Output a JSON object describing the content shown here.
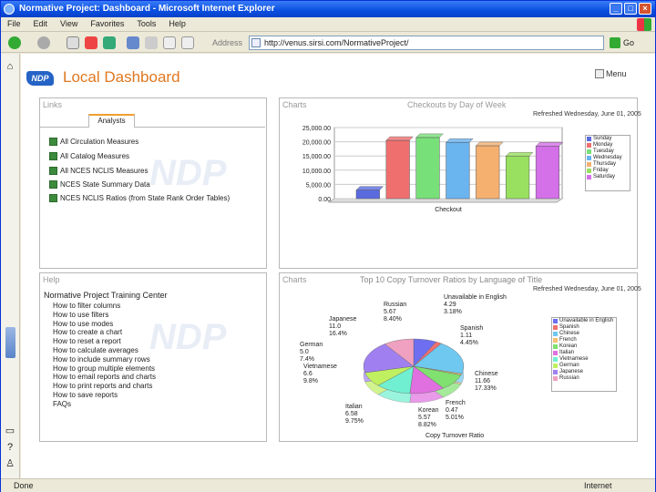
{
  "window": {
    "title": "Normative Project: Dashboard - Microsoft Internet Explorer"
  },
  "menu": [
    "File",
    "Edit",
    "View",
    "Favorites",
    "Tools",
    "Help"
  ],
  "address": {
    "label": "Address",
    "url": "http://venus.sirsi.com/NormativeProject/",
    "go": "Go"
  },
  "page": {
    "logo": "NDP",
    "title": "Local Dashboard",
    "menu_link": "Menu"
  },
  "links_panel": {
    "title": "Links",
    "tab": "Analysts",
    "items": [
      "All Circulation Measures",
      "All Catalog Measures",
      "All NCES NCLIS Measures",
      "NCES State Summary Data",
      "NCES NCLIS Ratios (from State Rank Order Tables)"
    ]
  },
  "help_panel": {
    "title": "Help",
    "heading": "Normative Project Training Center",
    "items": [
      "How to filter columns",
      "How to use filters",
      "How to use modes",
      "How to create a chart",
      "How to reset a report",
      "How to calculate averages",
      "How to include summary rows",
      "How to group multiple elements",
      "How to email reports and charts",
      "How to print reports and charts",
      "How to save reports",
      "FAQs"
    ]
  },
  "bar_panel": {
    "label": "Charts",
    "refreshed": "Refreshed Wednesday, June 01, 2005"
  },
  "pie_panel": {
    "label": "Charts",
    "refreshed": "Refreshed Wednesday, June 01, 2005"
  },
  "chart_data": [
    {
      "type": "bar",
      "title": "Checkouts by Day of Week",
      "xlabel": "Checkout",
      "ylim": [
        0,
        25000
      ],
      "ticks": [
        "0.00",
        "5,000.00",
        "10,000.00",
        "15,000.00",
        "20,000.00",
        "25,000.00"
      ],
      "series": [
        {
          "name": "Sunday",
          "values": [
            3000
          ],
          "color": "#5a6be0"
        },
        {
          "name": "Monday",
          "values": [
            20500
          ],
          "color": "#ef6f6f"
        },
        {
          "name": "Tuesday",
          "values": [
            21500
          ],
          "color": "#78e078"
        },
        {
          "name": "Wednesday",
          "values": [
            19800
          ],
          "color": "#6ab4f0"
        },
        {
          "name": "Thursday",
          "values": [
            18600
          ],
          "color": "#f5b070"
        },
        {
          "name": "Friday",
          "values": [
            15000
          ],
          "color": "#9ae060"
        },
        {
          "name": "Saturday",
          "values": [
            18500
          ],
          "color": "#d470e8"
        }
      ]
    },
    {
      "type": "pie",
      "title": "Top 10 Copy Turnover Ratios by Language of Title",
      "xlabel": "Copy Turnover Ratio",
      "series": [
        {
          "name": "Unavailable in English",
          "value": 4.29,
          "percent": "3.18%",
          "color": "#6e6ef0"
        },
        {
          "name": "Spanish",
          "value": 1.11,
          "percent": "4.45%",
          "color": "#ef7070"
        },
        {
          "name": "Chinese",
          "value": 11.66,
          "percent": "17.33%",
          "color": "#6ec8f0"
        },
        {
          "name": "French",
          "value": 0.47,
          "percent": "5.01%",
          "color": "#f7c070"
        },
        {
          "name": "Korean",
          "value": 5.57,
          "percent": "8.82%",
          "color": "#80e070"
        },
        {
          "name": "Italian",
          "value": 6.58,
          "percent": "9.75%",
          "color": "#e070e0"
        },
        {
          "name": "Vietnamese",
          "value": 6.6,
          "percent": "9.8%",
          "color": "#70f0d0"
        },
        {
          "name": "German",
          "value": 5.0,
          "percent": "7.4%",
          "color": "#c0f060"
        },
        {
          "name": "Japanese",
          "value": 11.0,
          "percent": "16.4%",
          "color": "#a080f0"
        },
        {
          "name": "Russian",
          "value": 5.67,
          "percent": "8.40%",
          "color": "#f0a0c0"
        }
      ],
      "labels": [
        {
          "name": "Russian",
          "value": "5.67",
          "percent": "8.40%"
        },
        {
          "name": "Unavailable in English",
          "value": "4.29",
          "percent": "3.18%"
        },
        {
          "name": "Spanish",
          "value": "1.11",
          "percent": "4.45%"
        },
        {
          "name": "Chinese",
          "value": "11.66",
          "percent": "17.33%"
        },
        {
          "name": "French",
          "value": "0.47",
          "percent": "5.01%"
        },
        {
          "name": "Korean",
          "value": "5.57",
          "percent": "8.82%"
        },
        {
          "name": "Italian",
          "value": "6.58",
          "percent": "9.75%"
        },
        {
          "name": "Vietnamese",
          "value": "6.6",
          "percent": "9.8%"
        },
        {
          "name": "German",
          "value": "5.0",
          "percent": "7.4%"
        },
        {
          "name": "Japanese",
          "value": "11.0",
          "percent": "16.4%"
        }
      ]
    }
  ],
  "status": {
    "left": "Done",
    "zone": "Internet"
  }
}
